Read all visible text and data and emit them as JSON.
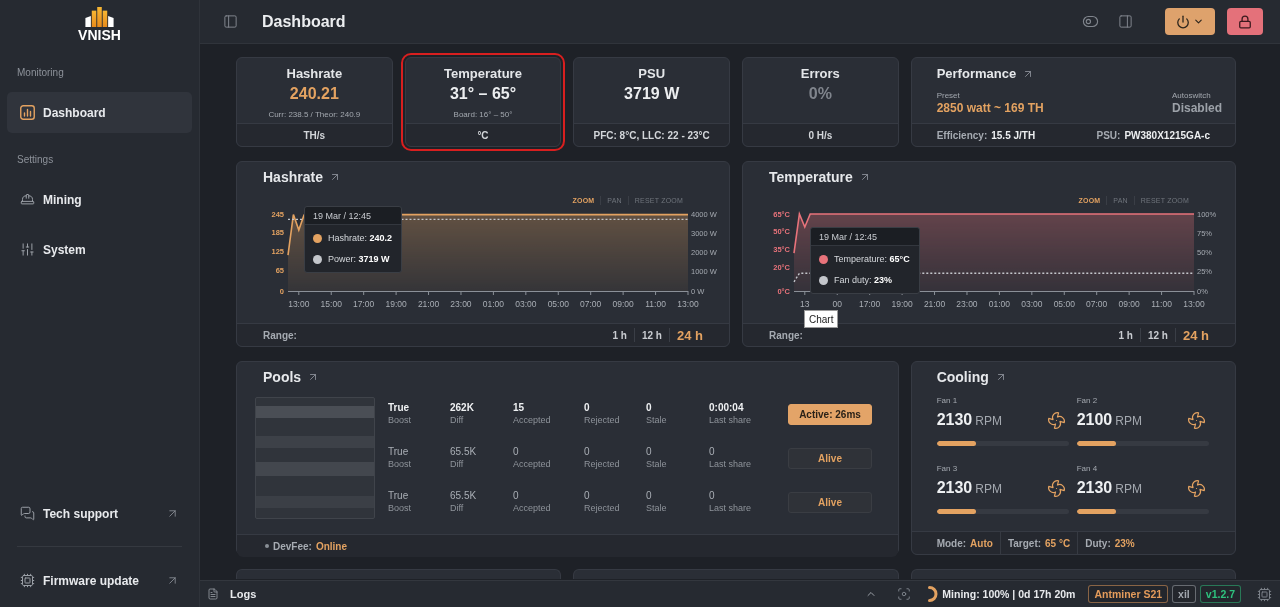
{
  "sidebar": {
    "logo": "VNISH",
    "sections": [
      {
        "label": "Monitoring",
        "items": [
          {
            "label": "Dashboard",
            "selected": true
          }
        ]
      },
      {
        "label": "Settings",
        "items": [
          {
            "label": "Mining",
            "selected": false
          },
          {
            "label": "System",
            "selected": false
          }
        ]
      }
    ],
    "links": [
      {
        "label": "Tech support"
      },
      {
        "label": "Firmware update"
      }
    ]
  },
  "header": {
    "title": "Dashboard"
  },
  "summary_cards": [
    {
      "title": "Hashrate",
      "value": "240.21",
      "kind": "accent",
      "detail": "Curr: 238.5 / Theor: 240.9",
      "footer": "TH/s",
      "highlighted": false
    },
    {
      "title": "Temperature",
      "value": "31° – 65°",
      "kind": "plain",
      "detail": "Board: 16° – 50°",
      "footer": "°C",
      "highlighted": true
    },
    {
      "title": "PSU",
      "value": "3719 W",
      "kind": "plain",
      "footer": "PFC: 8°C, LLC: 22 - 23°C",
      "highlighted": false
    },
    {
      "title": "Errors",
      "value": "0%",
      "kind": "muted",
      "footer": "0 H/s",
      "highlighted": false
    }
  ],
  "performance": {
    "title": "Performance",
    "preset_label": "Preset",
    "preset": "2850 watt ~ 169 TH",
    "autoswitch_label": "Autoswitch",
    "autoswitch": "Disabled",
    "footer": [
      {
        "label": "Efficiency:",
        "value": "15.5 J/TH"
      },
      {
        "label": "PSU:",
        "value": "PW380X1215GA-c"
      }
    ]
  },
  "charts": [
    {
      "title": "Hashrate",
      "controls": [
        {
          "label": "ZOOM",
          "selected": true
        },
        {
          "label": "PAN",
          "selected": false
        },
        {
          "label": "RESET ZOOM",
          "selected": false
        }
      ],
      "chart_data": {
        "type": "area",
        "categories": [
          null,
          null,
          "13:00",
          null,
          null,
          null,
          null,
          null,
          "15:00",
          null,
          null,
          null,
          null,
          null,
          "17:00",
          null,
          null,
          null,
          null,
          null,
          "19:00",
          null,
          null,
          null,
          null,
          null,
          "21:00",
          null,
          null,
          null,
          null,
          null,
          "23:00",
          null,
          null,
          null,
          null,
          null,
          "01:00",
          null,
          null,
          null,
          null,
          null,
          "03:00",
          null,
          null,
          null,
          null,
          null,
          "05:00",
          null,
          null,
          null,
          null,
          null,
          "07:00",
          null,
          null,
          null,
          null,
          null,
          "09:00",
          null,
          null,
          null,
          null,
          null,
          "11:00",
          null,
          null,
          null,
          null,
          null,
          "13:00"
        ],
        "series": [
          {
            "color": "#e3a261",
            "values": [
              114,
              243,
              194,
              243,
              null,
              null,
              null,
              null,
              null,
              null,
              null,
              null,
              null,
              null,
              null,
              null,
              null,
              null,
              null,
              null,
              null,
              243,
              243,
              243,
              243,
              243,
              243,
              243,
              243,
              243,
              243,
              243,
              243,
              243,
              243,
              243,
              243,
              243,
              243,
              243,
              243,
              243,
              243,
              243,
              243,
              243,
              243,
              243,
              243,
              243,
              243,
              243,
              243,
              243,
              243,
              243,
              243,
              243,
              243,
              243,
              243,
              243,
              243,
              243,
              243,
              243,
              243,
              243,
              243,
              243,
              243,
              243,
              243,
              243,
              243
            ]
          },
          {
            "color": "#c3c6cb",
            "type": "line",
            "axis": "y2",
            "line_style": "dotted",
            "values": [
              3719,
              3719,
              3719,
              3719,
              null,
              null,
              null,
              null,
              null,
              null,
              null,
              null,
              null,
              null,
              null,
              null,
              null,
              null,
              null,
              null,
              null,
              3719,
              3719,
              3719,
              3719,
              3719,
              3719,
              3719,
              3719,
              3719,
              3719,
              3719,
              3719,
              3719,
              3719,
              3719,
              3719,
              3719,
              3719,
              3719,
              3719,
              3719,
              3719,
              3719,
              3719,
              3719,
              3719,
              3719,
              3719,
              3719,
              3719,
              3719,
              3719,
              3719,
              3719,
              3719,
              3719,
              3719,
              3719,
              3719,
              3719,
              3719,
              3719,
              3719,
              3719,
              3719,
              3719,
              3719,
              3719,
              3719,
              3719,
              3719,
              3719,
              3719,
              3719
            ]
          }
        ],
        "ylim": [
          0,
          245
        ],
        "yticks": [
          0,
          65,
          125,
          185,
          245
        ],
        "y2lim": [
          0,
          4000
        ],
        "y2ticks": [
          {
            "value": 0,
            "label": "0 W"
          },
          {
            "value": 1000,
            "label": "1000 W"
          },
          {
            "value": 2000,
            "label": "2000 W"
          },
          {
            "value": 3000,
            "label": "3000 W"
          },
          {
            "value": 4000,
            "label": "4000 W"
          }
        ]
      },
      "tooltip": {
        "title": "19 Mar / 12:45",
        "rows": [
          "Hashrate: **240.2**",
          "Power: **3719 W**"
        ]
      },
      "range_label": "Range:",
      "ranges": [
        {
          "label": "1 h",
          "selected": false
        },
        {
          "label": "12 h",
          "selected": false
        },
        {
          "label": "24 h",
          "selected": true
        }
      ]
    },
    {
      "title": "Temperature",
      "controls": [
        {
          "label": "ZOOM",
          "selected": true
        },
        {
          "label": "PAN",
          "selected": false
        },
        {
          "label": "RESET ZOOM",
          "selected": false
        }
      ],
      "chart_data": {
        "type": "area",
        "categories": [
          null,
          null,
          "13",
          null,
          null,
          null,
          null,
          null,
          "00",
          null,
          null,
          null,
          null,
          null,
          "17:00",
          null,
          null,
          null,
          null,
          null,
          "19:00",
          null,
          null,
          null,
          null,
          null,
          "21:00",
          null,
          null,
          null,
          null,
          null,
          "23:00",
          null,
          null,
          null,
          null,
          null,
          "01:00",
          null,
          null,
          null,
          null,
          null,
          "03:00",
          null,
          null,
          null,
          null,
          null,
          "05:00",
          null,
          null,
          null,
          null,
          null,
          "07:00",
          null,
          null,
          null,
          null,
          null,
          "09:00",
          null,
          null,
          null,
          null,
          null,
          "11:00",
          null,
          null,
          null,
          null,
          null,
          "13:00"
        ],
        "series": [
          {
            "color": "#e8737b",
            "values": [
              32,
              65,
              54,
              65,
              65,
              65,
              65,
              65,
              65,
              65,
              65,
              65,
              65,
              65,
              65,
              65,
              65,
              65,
              65,
              65,
              65,
              65,
              65,
              65,
              65,
              65,
              65,
              65,
              65,
              65,
              65,
              65,
              65,
              65,
              65,
              65,
              65,
              65,
              65,
              65,
              65,
              65,
              65,
              65,
              65,
              65,
              65,
              65,
              65,
              65,
              65,
              65,
              65,
              65,
              65,
              65,
              65,
              65,
              65,
              65,
              65,
              65,
              65,
              65,
              65,
              65,
              65,
              65,
              65,
              65,
              65,
              65,
              65,
              65,
              65
            ]
          },
          {
            "color": "#c3c6cb",
            "type": "line",
            "axis": "y2",
            "line_style": "dotted",
            "values": [
              12,
              23,
              23,
              23,
              null,
              null,
              null,
              null,
              null,
              null,
              null,
              null,
              null,
              null,
              null,
              null,
              null,
              null,
              null,
              null,
              null,
              null,
              null,
              23,
              23,
              23,
              23,
              23,
              23,
              23,
              23,
              23,
              23,
              23,
              23,
              23,
              23,
              23,
              23,
              23,
              23,
              23,
              23,
              23,
              23,
              23,
              23,
              23,
              23,
              23,
              23,
              23,
              23,
              23,
              23,
              23,
              23,
              23,
              23,
              23,
              23,
              23,
              23,
              23,
              23,
              23,
              23,
              23,
              23,
              23,
              23,
              23,
              23,
              23,
              23
            ]
          }
        ],
        "ylim": [
          0,
          65
        ],
        "yticks": [
          {
            "value": 0,
            "label": "0°C"
          },
          {
            "value": 20,
            "label": "20°C"
          },
          {
            "value": 35,
            "label": "35°C"
          },
          {
            "value": 50,
            "label": "50°C"
          },
          {
            "value": 65,
            "label": "65°C"
          }
        ],
        "y2lim": [
          0,
          100
        ],
        "y2ticks": [
          {
            "value": 0,
            "label": "0%"
          },
          {
            "value": 25,
            "label": "25%"
          },
          {
            "value": 50,
            "label": "50%"
          },
          {
            "value": 75,
            "label": "75%"
          },
          {
            "value": 100,
            "label": "100%"
          }
        ]
      },
      "tooltip": {
        "title": "19 Mar / 12:45",
        "rows": [
          "Temperature: **65°C**",
          "Fan duty: **23%**"
        ]
      },
      "hover_tip": "Chart",
      "range_label": "Range:",
      "ranges": [
        {
          "label": "1 h",
          "selected": false
        },
        {
          "label": "12 h",
          "selected": false
        },
        {
          "label": "24 h",
          "selected": true
        }
      ]
    }
  ],
  "pools": {
    "title": "Pools",
    "rows": [
      {
        "active": true,
        "status": "Active: 26ms",
        "cells": [
          {
            "value": "True",
            "label": "Boost"
          },
          {
            "value": "262K",
            "label": "Diff"
          },
          {
            "value": "15",
            "label": "Accepted"
          },
          {
            "value": "0",
            "label": "Rejected"
          },
          {
            "value": "0",
            "label": "Stale"
          },
          {
            "value": "0:00:04",
            "label": "Last share"
          }
        ]
      },
      {
        "active": false,
        "status": "Alive",
        "cells": [
          {
            "value": "True",
            "label": "Boost"
          },
          {
            "value": "65.5K",
            "label": "Diff"
          },
          {
            "value": "0",
            "label": "Accepted"
          },
          {
            "value": "0",
            "label": "Rejected"
          },
          {
            "value": "0",
            "label": "Stale"
          },
          {
            "value": "0",
            "label": "Last share"
          }
        ]
      },
      {
        "active": false,
        "status": "Alive",
        "cells": [
          {
            "value": "True",
            "label": "Boost"
          },
          {
            "value": "65.5K",
            "label": "Diff"
          },
          {
            "value": "0",
            "label": "Accepted"
          },
          {
            "value": "0",
            "label": "Rejected"
          },
          {
            "value": "0",
            "label": "Stale"
          },
          {
            "value": "0",
            "label": "Last share"
          }
        ]
      }
    ],
    "devfee": {
      "label": "DevFee:",
      "value": "Online"
    }
  },
  "cooling": {
    "title": "Cooling",
    "fans": [
      {
        "name": "Fan 1",
        "rpm": "2130",
        "unit": "RPM",
        "level": 0.3
      },
      {
        "name": "Fan 2",
        "rpm": "2100",
        "unit": "RPM",
        "level": 0.3
      },
      {
        "name": "Fan 3",
        "rpm": "2130",
        "unit": "RPM",
        "level": 0.3
      },
      {
        "name": "Fan 4",
        "rpm": "2130",
        "unit": "RPM",
        "level": 0.3
      }
    ],
    "footer": [
      {
        "label": "Mode:",
        "value": "Auto"
      },
      {
        "label": "Target:",
        "value": "65 °C"
      },
      {
        "label": "Duty:",
        "value": "23%"
      }
    ]
  },
  "status_bar": {
    "logs": "Logs",
    "mining": "Mining: 100% | 0d 17h 20m",
    "badges": [
      {
        "text": "Antminer S21",
        "color": "#e39b5b"
      },
      {
        "text": "xil",
        "color": "#a3a8af"
      },
      {
        "text": "v1.2.7",
        "color": "#2ec27e"
      }
    ]
  }
}
